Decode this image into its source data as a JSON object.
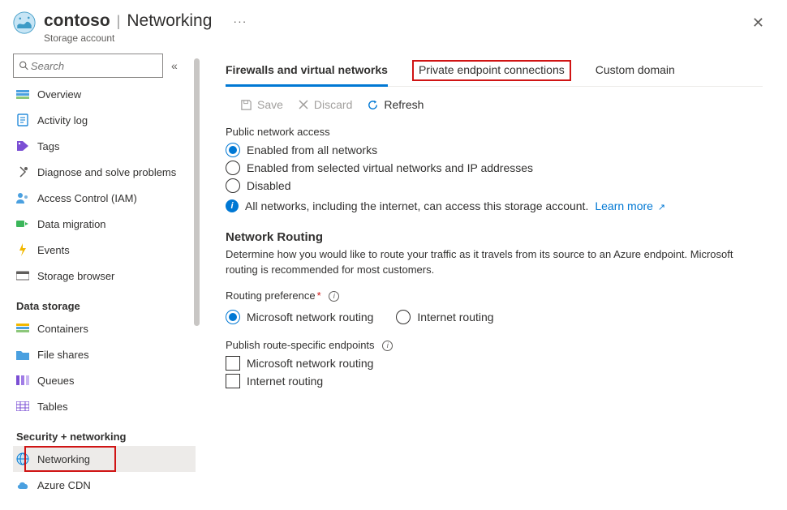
{
  "header": {
    "resource_name": "contoso",
    "page_name": "Networking",
    "resource_type": "Storage account"
  },
  "sidebar": {
    "search_placeholder": "Search",
    "items": [
      {
        "label": "Overview"
      },
      {
        "label": "Activity log"
      },
      {
        "label": "Tags"
      },
      {
        "label": "Diagnose and solve problems"
      },
      {
        "label": "Access Control (IAM)"
      },
      {
        "label": "Data migration"
      },
      {
        "label": "Events"
      },
      {
        "label": "Storage browser"
      }
    ],
    "group_data_storage_title": "Data storage",
    "data_storage_items": [
      {
        "label": "Containers"
      },
      {
        "label": "File shares"
      },
      {
        "label": "Queues"
      },
      {
        "label": "Tables"
      }
    ],
    "group_security_title": "Security + networking",
    "security_items": [
      {
        "label": "Networking"
      },
      {
        "label": "Azure CDN"
      }
    ]
  },
  "tabs": {
    "firewalls": "Firewalls and virtual networks",
    "private_endpoints": "Private endpoint connections",
    "custom_domain": "Custom domain"
  },
  "toolbar": {
    "save": "Save",
    "discard": "Discard",
    "refresh": "Refresh"
  },
  "public_access": {
    "label": "Public network access",
    "opt_all": "Enabled from all networks",
    "opt_selected": "Enabled from selected virtual networks and IP addresses",
    "opt_disabled": "Disabled",
    "info": "All networks, including the internet, can access this storage account.",
    "learn_more": "Learn more"
  },
  "routing": {
    "title": "Network Routing",
    "desc": "Determine how you would like to route your traffic as it travels from its source to an Azure endpoint. Microsoft routing is recommended for most customers.",
    "pref_label": "Routing preference",
    "opt_ms": "Microsoft network routing",
    "opt_internet": "Internet routing",
    "publish_label": "Publish route-specific endpoints",
    "cb_ms": "Microsoft network routing",
    "cb_internet": "Internet routing"
  }
}
